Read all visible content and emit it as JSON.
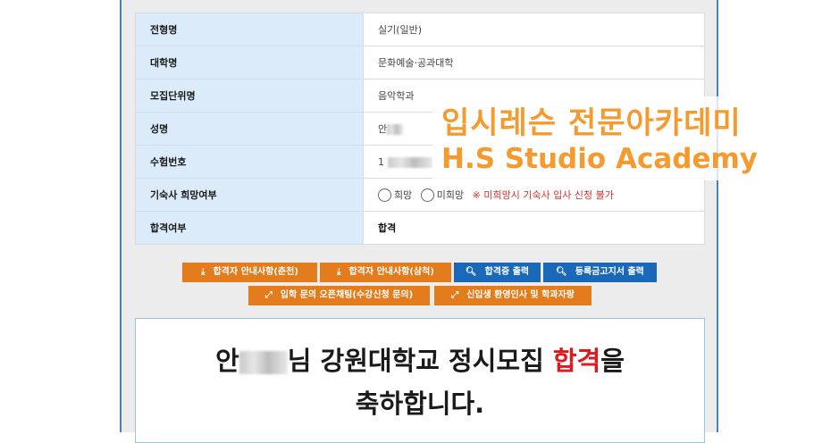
{
  "table": {
    "rows": [
      {
        "label": "전형명",
        "value": "실기(일반)"
      },
      {
        "label": "대학명",
        "value": "문화예술·공과대학"
      },
      {
        "label": "모집단위명",
        "value": "음악학과"
      },
      {
        "label": "성명",
        "value": "안"
      },
      {
        "label": "수험번호",
        "value": "1"
      },
      {
        "label": "기숙사 희망여부",
        "options": [
          "희망",
          "미희망"
        ],
        "notice": "※ 미희망시 기숙사 입사 신청 불가"
      },
      {
        "label": "합격여부",
        "value": "합격"
      }
    ]
  },
  "watermark": {
    "line1": "입시레슨 전문아카데미",
    "line2": "H.S Studio Academy",
    "color": "#f59a2e"
  },
  "buttons": {
    "row1": [
      {
        "label": "합격자 안내사항(춘천)",
        "icon": "download-icon",
        "color": "#e37c1c"
      },
      {
        "label": "합격자 안내사항(삼척)",
        "icon": "download-icon",
        "color": "#e37c1c"
      },
      {
        "label": "합격증 출력",
        "icon": "search-icon",
        "color": "#1a68b8"
      },
      {
        "label": "등록금고지서 출력",
        "icon": "search-icon",
        "color": "#1a68b8"
      }
    ],
    "row2": [
      {
        "label": "입학 문의 오픈채팅(수강신청 문의)",
        "icon": "external-link-icon",
        "color": "#e37c1c"
      },
      {
        "label": "신입생 환영인사 및 학과자랑",
        "icon": "external-link-icon",
        "color": "#e37c1c"
      }
    ]
  },
  "congrats": {
    "name_prefix": "안",
    "text_before": "님 강원대학교 정시모집 ",
    "pass_word": "합격",
    "text_after": "을",
    "line2": "축하합니다.",
    "pass_color": "#e0191e"
  }
}
